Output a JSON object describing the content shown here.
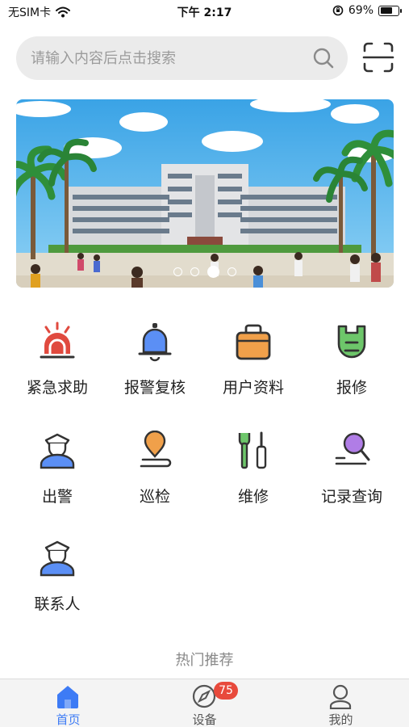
{
  "status_bar": {
    "carrier": "无SIM卡",
    "time": "下午 2:17",
    "battery_percent": "69%",
    "battery_level": 0.69
  },
  "search": {
    "placeholder": "请输入内容后点击搜索",
    "value": ""
  },
  "banner": {
    "slide_count": 4,
    "active_slide": 3
  },
  "functions": [
    {
      "label": "紧急求助",
      "icon": "alarm-siren-icon"
    },
    {
      "label": "报警复核",
      "icon": "bell-icon"
    },
    {
      "label": "用户资料",
      "icon": "briefcase-icon"
    },
    {
      "label": "报修",
      "icon": "repair-tag-icon"
    },
    {
      "label": "出警",
      "icon": "police-officer-icon"
    },
    {
      "label": "巡检",
      "icon": "location-pin-icon"
    },
    {
      "label": "维修",
      "icon": "wrench-screwdriver-icon"
    },
    {
      "label": "记录查询",
      "icon": "search-record-icon"
    },
    {
      "label": "联系人",
      "icon": "contact-person-icon"
    }
  ],
  "hot_recommend": {
    "title": "热门推荐"
  },
  "tab_bar": {
    "tabs": [
      {
        "label": "首页",
        "icon": "home-icon",
        "active": true
      },
      {
        "label": "设备",
        "icon": "compass-icon",
        "badge": "75"
      },
      {
        "label": "我的",
        "icon": "user-icon"
      }
    ]
  },
  "colors": {
    "accent": "#3d7bf5",
    "alarm_red": "#e04a3f",
    "bell_blue": "#5b8ff5",
    "orange": "#f0a04a",
    "green": "#6dc66a",
    "purple": "#b07de6",
    "badge_red": "#e84a3c"
  }
}
